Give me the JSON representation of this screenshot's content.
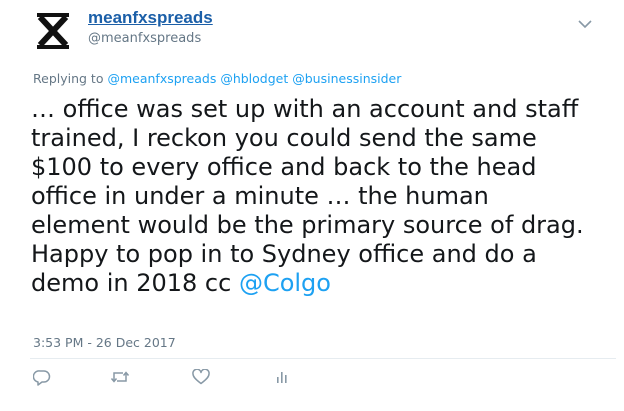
{
  "author": {
    "display_name": "meanfxspreads",
    "handle": "@meanfxspreads"
  },
  "reply_context": {
    "prefix": "Replying to",
    "mentions": [
      "@meanfxspreads",
      "@hblodget",
      "@businessinsider"
    ]
  },
  "tweet": {
    "lines": [
      "… office was set up with an account and staff",
      "trained, I reckon you could send the same",
      "$100 to every office and back to the head",
      "office in under a minute … the human",
      "element would be the primary source of drag.",
      "Happy to pop in to Sydney office and do a"
    ],
    "last_line_text": "demo in 2018 cc ",
    "last_line_mention": "@Colgo"
  },
  "timestamp": "3:53 PM - 26 Dec 2017",
  "actions": {
    "reply": "reply-icon",
    "retweet": "retweet-icon",
    "like": "heart-icon",
    "analytics": "analytics-icon"
  },
  "colors": {
    "link": "#1da1f2",
    "name": "#1b5fa8",
    "muted": "#657786",
    "text": "#14171a",
    "divider": "#e6ecf0"
  }
}
